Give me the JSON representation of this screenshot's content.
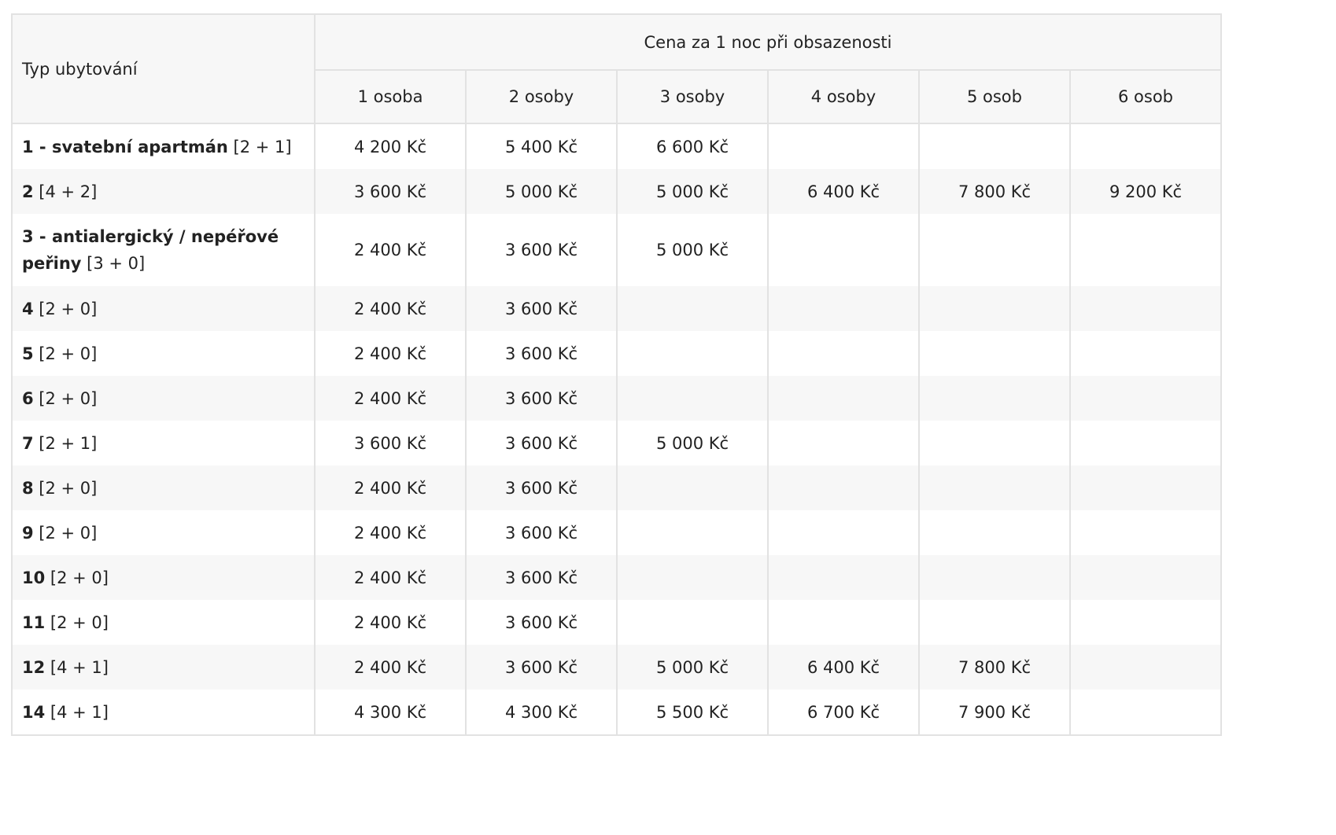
{
  "table": {
    "header_type": "Typ ubytování",
    "header_price": "Cena za 1 noc při obsazenosti",
    "occupancy": [
      "1 osoba",
      "2 osoby",
      "3 osoby",
      "4 osoby",
      "5 osob",
      "6 osob"
    ],
    "rows": [
      {
        "room_bold": "1 - svatební apartmán",
        "room_cap": " [2 + 1]",
        "prices": [
          "4 200 Kč",
          "5 400 Kč",
          "6 600 Kč",
          "",
          "",
          ""
        ]
      },
      {
        "room_bold": "2",
        "room_cap": " [4 + 2]",
        "prices": [
          "3 600 Kč",
          "5 000 Kč",
          "5 000 Kč",
          "6 400 Kč",
          "7 800 Kč",
          "9 200 Kč"
        ]
      },
      {
        "room_bold": "3 - antialergický / nepéřové peřiny",
        "room_cap": " [3 + 0]",
        "prices": [
          "2 400 Kč",
          "3 600 Kč",
          "5 000 Kč",
          "",
          "",
          ""
        ]
      },
      {
        "room_bold": "4",
        "room_cap": " [2 + 0]",
        "prices": [
          "2 400 Kč",
          "3 600 Kč",
          "",
          "",
          "",
          ""
        ]
      },
      {
        "room_bold": "5",
        "room_cap": " [2 + 0]",
        "prices": [
          "2 400 Kč",
          "3 600 Kč",
          "",
          "",
          "",
          ""
        ]
      },
      {
        "room_bold": "6",
        "room_cap": " [2 + 0]",
        "prices": [
          "2 400 Kč",
          "3 600 Kč",
          "",
          "",
          "",
          ""
        ]
      },
      {
        "room_bold": "7",
        "room_cap": " [2 + 1]",
        "prices": [
          "3 600 Kč",
          "3 600 Kč",
          "5 000 Kč",
          "",
          "",
          ""
        ]
      },
      {
        "room_bold": "8",
        "room_cap": " [2 + 0]",
        "prices": [
          "2 400 Kč",
          "3 600 Kč",
          "",
          "",
          "",
          ""
        ]
      },
      {
        "room_bold": "9",
        "room_cap": " [2 + 0]",
        "prices": [
          "2 400 Kč",
          "3 600 Kč",
          "",
          "",
          "",
          ""
        ]
      },
      {
        "room_bold": "10",
        "room_cap": " [2 + 0]",
        "prices": [
          "2 400 Kč",
          "3 600 Kč",
          "",
          "",
          "",
          ""
        ]
      },
      {
        "room_bold": "11",
        "room_cap": " [2 + 0]",
        "prices": [
          "2 400 Kč",
          "3 600 Kč",
          "",
          "",
          "",
          ""
        ]
      },
      {
        "room_bold": "12",
        "room_cap": " [4 + 1]",
        "prices": [
          "2 400 Kč",
          "3 600 Kč",
          "5 000 Kč",
          "6 400 Kč",
          "7 800 Kč",
          ""
        ]
      },
      {
        "room_bold": "14",
        "room_cap": " [4 + 1]",
        "prices": [
          "4 300 Kč",
          "4 300 Kč",
          "5 500 Kč",
          "6 700 Kč",
          "7 900 Kč",
          ""
        ]
      }
    ]
  }
}
